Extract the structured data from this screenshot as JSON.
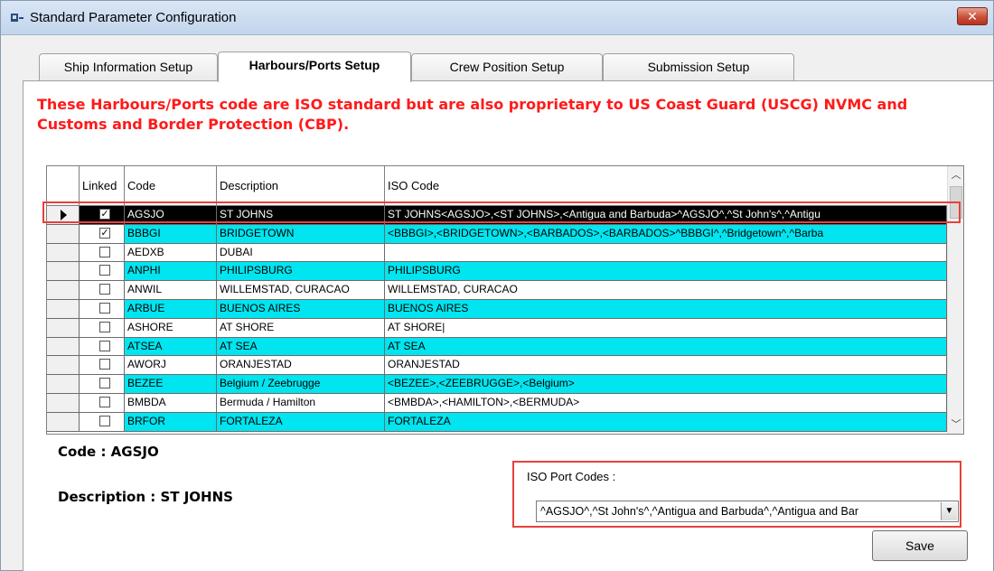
{
  "window": {
    "title": "Standard Parameter Configuration",
    "close_glyph": "✕"
  },
  "tabs": [
    {
      "label": "Ship Information Setup",
      "active": false
    },
    {
      "label": "Harbours/Ports Setup",
      "active": true
    },
    {
      "label": "Crew Position Setup",
      "active": false
    },
    {
      "label": "Submission Setup",
      "active": false
    }
  ],
  "notice": "These Harbours/Ports code are ISO standard but are also proprietary to US Coast Guard (USCG) NVMC and Customs and Border Protection (CBP).",
  "grid": {
    "columns": [
      "",
      "Linked",
      "Code",
      "Description",
      "ISO Code"
    ],
    "rows": [
      {
        "linked": true,
        "code": "AGSJO",
        "description": "ST JOHNS",
        "iso": "ST JOHNS<AGSJO>,<ST JOHNS>,<Antigua and Barbuda>^AGSJO^,^St John's^,^Antigu",
        "style": "selected"
      },
      {
        "linked": true,
        "code": "BBBGI",
        "description": "BRIDGETOWN",
        "iso": "<BBBGI>,<BRIDGETOWN>,<BARBADOS>,<BARBADOS>^BBBGI^,^Bridgetown^,^Barba",
        "style": "cyan"
      },
      {
        "linked": false,
        "code": "AEDXB",
        "description": "DUBAI",
        "iso": "",
        "style": "white"
      },
      {
        "linked": false,
        "code": "ANPHI",
        "description": "PHILIPSBURG",
        "iso": "PHILIPSBURG",
        "style": "cyan"
      },
      {
        "linked": false,
        "code": "ANWIL",
        "description": "WILLEMSTAD, CURACAO",
        "iso": "WILLEMSTAD, CURACAO",
        "style": "white"
      },
      {
        "linked": false,
        "code": "ARBUE",
        "description": "BUENOS AIRES",
        "iso": "BUENOS AIRES",
        "style": "cyan"
      },
      {
        "linked": false,
        "code": "ASHORE",
        "description": "AT SHORE",
        "iso": "AT SHORE|",
        "style": "white"
      },
      {
        "linked": false,
        "code": "ATSEA",
        "description": "AT SEA",
        "iso": "AT SEA",
        "style": "cyan"
      },
      {
        "linked": false,
        "code": "AWORJ",
        "description": "ORANJESTAD",
        "iso": "ORANJESTAD",
        "style": "white"
      },
      {
        "linked": false,
        "code": "BEZEE",
        "description": "Belgium / Zeebrugge",
        "iso": "<BEZEE>,<ZEEBRUGGE>,<Belgium>",
        "style": "cyan"
      },
      {
        "linked": false,
        "code": "BMBDA",
        "description": "Bermuda / Hamilton",
        "iso": "<BMBDA>,<HAMILTON>,<BERMUDA>",
        "style": "white"
      },
      {
        "linked": false,
        "code": "BRFOR",
        "description": "FORTALEZA",
        "iso": "FORTALEZA",
        "style": "cyan"
      }
    ]
  },
  "details": {
    "code_label": "Code : AGSJO",
    "description_label": "Description : ST JOHNS"
  },
  "iso_port_codes": {
    "label": "ISO Port Codes :",
    "value": "^AGSJO^,^St John's^,^Antigua and Barbuda^,^Antigua and Bar"
  },
  "save_label": "Save",
  "colors": {
    "row_highlight": "#00e5ef",
    "notice": "#ff1a1a",
    "callout": "#e8413c"
  }
}
